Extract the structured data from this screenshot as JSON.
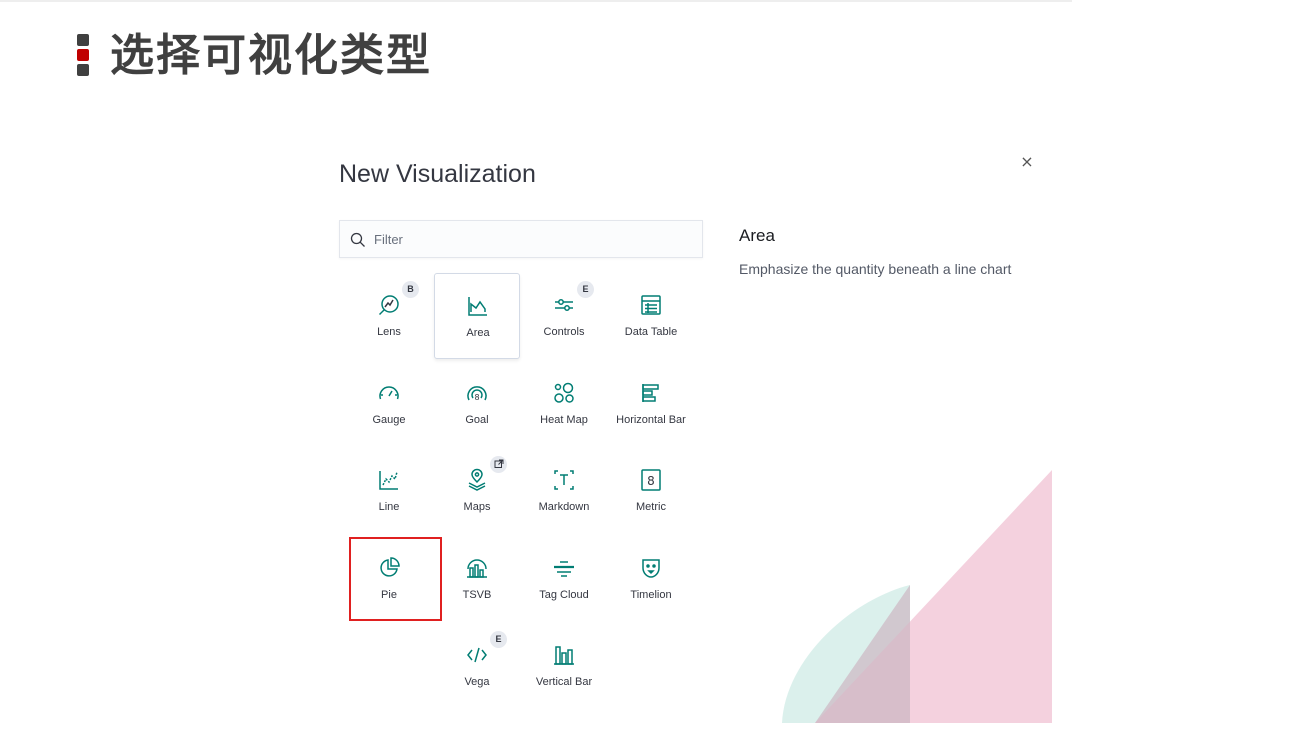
{
  "slide": {
    "title": "选择可视化类型"
  },
  "flyout": {
    "title": "New Visualization",
    "filter_placeholder": "Filter",
    "close_symbol": "×"
  },
  "detail": {
    "title": "Area",
    "description": "Emphasize the quantity beneath a line chart"
  },
  "tiles": [
    {
      "label": "Lens",
      "icon": "lens-icon",
      "badge": "B"
    },
    {
      "label": "Area",
      "icon": "area-chart-icon",
      "selected": true
    },
    {
      "label": "Controls",
      "icon": "controls-icon",
      "badge": "E"
    },
    {
      "label": "Data Table",
      "icon": "data-table-icon"
    },
    {
      "label": "Gauge",
      "icon": "gauge-icon"
    },
    {
      "label": "Goal",
      "icon": "goal-icon"
    },
    {
      "label": "Heat Map",
      "icon": "heat-map-icon"
    },
    {
      "label": "Horizontal Bar",
      "icon": "horizontal-bar-icon"
    },
    {
      "label": "Line",
      "icon": "line-chart-icon"
    },
    {
      "label": "Maps",
      "icon": "maps-icon",
      "badge_icon": "external-link-icon"
    },
    {
      "label": "Markdown",
      "icon": "markdown-icon"
    },
    {
      "label": "Metric",
      "icon": "metric-icon"
    },
    {
      "label": "Pie",
      "icon": "pie-chart-icon",
      "highlighted": true
    },
    {
      "label": "TSVB",
      "icon": "tsvb-icon"
    },
    {
      "label": "Tag Cloud",
      "icon": "tag-cloud-icon"
    },
    {
      "label": "Timelion",
      "icon": "timelion-icon"
    },
    {
      "label": "Vega",
      "icon": "vega-icon",
      "badge": "E"
    },
    {
      "label": "Vertical Bar",
      "icon": "vertical-bar-icon"
    }
  ],
  "colors": {
    "icon": "#017d73",
    "highlight_frame": "#e02020",
    "slide_mark_red": "#c00000",
    "slide_mark_gray": "#404040"
  }
}
